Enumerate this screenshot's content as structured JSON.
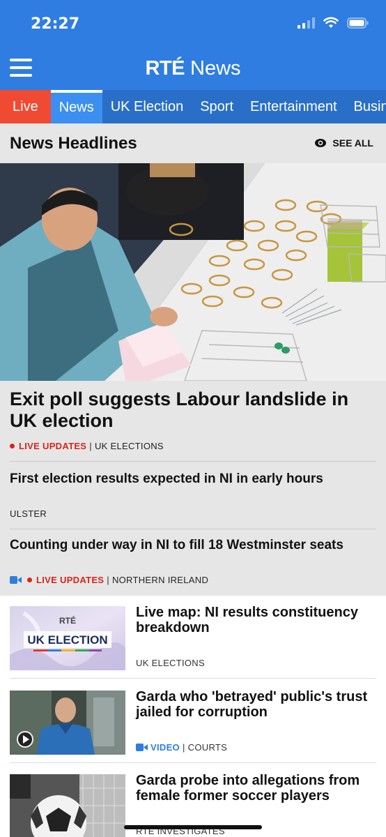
{
  "status": {
    "time": "22:27"
  },
  "header": {
    "logo_brand": "RTÉ",
    "logo_product": "News"
  },
  "tabs": [
    {
      "label": "Live"
    },
    {
      "label": "News"
    },
    {
      "label": "UK Election"
    },
    {
      "label": "Sport"
    },
    {
      "label": "Entertainment"
    },
    {
      "label": "Busin"
    }
  ],
  "section": {
    "title": "News Headlines",
    "see_all": "SEE ALL"
  },
  "lead": {
    "title": "Exit poll suggests Labour landslide in UK election",
    "live_label": "LIVE UPDATES",
    "separator": "|",
    "category": "UK ELECTIONS"
  },
  "headlines": [
    {
      "title": "First election results expected in NI in early hours",
      "category": "ULSTER"
    },
    {
      "title": "Counting under way in NI to fill 18 Westminster seats",
      "live_label": "LIVE UPDATES",
      "separator": "|",
      "category": "NORTHERN IRELAND"
    }
  ],
  "thumb_text": {
    "brand": "RTÉ",
    "banner": "UK ELECTION"
  },
  "stories": [
    {
      "title": "Live map: NI results constituency breakdown",
      "category": "UK ELECTIONS"
    },
    {
      "title": "Garda who 'betrayed' public's trust jailed for corruption",
      "video_label": "VIDEO",
      "separator": "|",
      "category": "COURTS"
    },
    {
      "title": "Garda probe into allegations from female former soccer players",
      "category": "RTÉ INVESTIGATES"
    }
  ]
}
